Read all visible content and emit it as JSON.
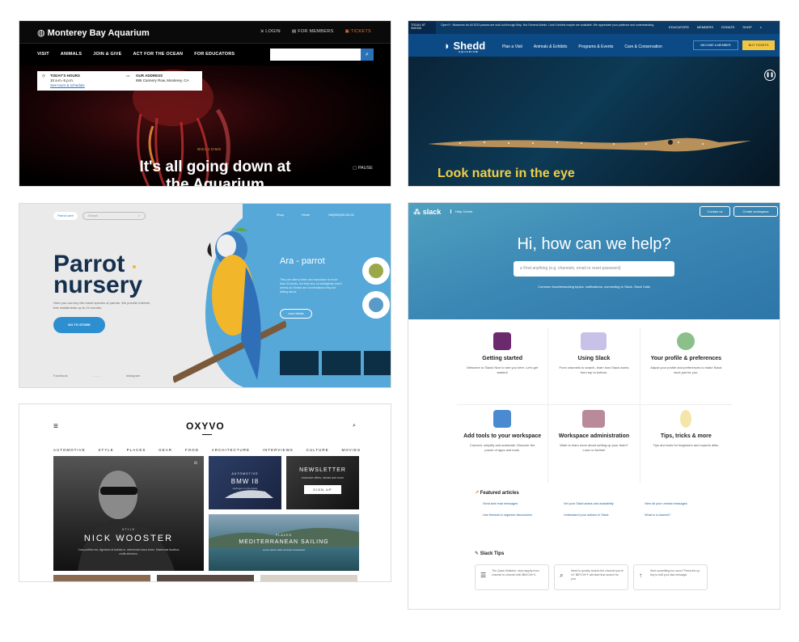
{
  "monterey": {
    "logo": "Monterey Bay Aquarium",
    "top_nav": [
      "LOGIN",
      "FOR MEMBERS",
      "TICKETS"
    ],
    "main_nav": [
      "VISIT",
      "ANIMALS",
      "JOIN & GIVE",
      "ACT FOR THE OCEAN",
      "FOR EDUCATORS"
    ],
    "hours_label": "TODAY'S HOURS",
    "hours_value": "10 a.m.-5 p.m.",
    "hours_link": "See tours & schedule",
    "address_label": "OUR ADDRESS",
    "address_value": "886 Cannery Row, Monterey, CA",
    "kicker": "WELCOME",
    "hero": "It's all going down at the Aquarium",
    "pause": "PAUSE"
  },
  "shedd": {
    "today_label": "TODAY AT SHEDD",
    "open_label": "Open 9",
    "alert": "Museums for All 2023 passes are sold out through May. Not General Admin. Limit 4 tickets maybe are available. We appreciate your patience and understanding.",
    "util_nav": [
      "EDUCATORS",
      "MEMBERS",
      "DONATE",
      "SHOP"
    ],
    "logo": "Shedd",
    "logo_sub": "AQUARIUM",
    "main_nav": [
      "Plan a Visit",
      "Animals & Exhibits",
      "Programs & Events",
      "Care & Conservation"
    ],
    "member_button": "BECOME A MEMBER",
    "tickets_button": "BUY TICKETS",
    "hero": "Look nature in the eye"
  },
  "parrot": {
    "logo": "Parrot care",
    "search_placeholder": "Search",
    "nav": [
      "Shop",
      "Home",
      "+38(000)000-00-00"
    ],
    "title_line1": "Parrot",
    "title_line2": "nursery",
    "description": "Here you can buy the rarest species of parrots. We provide interest-free installments up to 24 months.",
    "store_button": "GO TO STORE",
    "footer": [
      "Facebook",
      "Instagram"
    ],
    "species_title": "Ara - parrot",
    "species_text": "They are able to learn and reproduce no more than 30 words, but they stun us intelligently that it seems as if these are conversations they are talking about.",
    "more_button": "more details"
  },
  "slack": {
    "logo": "slack",
    "help_centre": "Help Centre",
    "contact_button": "Contact us",
    "create_button": "Create workspace",
    "title": "Hi, how can we help?",
    "search_placeholder": "Find anything (e.g. channels, email or reset password)",
    "common_topics": "Common troubleshooting topics: notifications, connecting to Slack, Slack Calls",
    "cards": [
      {
        "title": "Getting started",
        "text": "Welcome to Slack! Nice to see you here. Let's get started!",
        "icon": "book-icon"
      },
      {
        "title": "Using Slack",
        "text": "From channels to search, learn how Slack works from top to bottom.",
        "icon": "screen-icon"
      },
      {
        "title": "Your profile & preferences",
        "text": "Adjust your profile and preferences to make Slack work just for you.",
        "icon": "profile-icon"
      },
      {
        "title": "Add tools to your workspace",
        "text": "Connect, simplify and automate. Discover the power of apps and tools.",
        "icon": "tools-icon"
      },
      {
        "title": "Workspace administration",
        "text": "Want to learn more about setting up your team? Look no further!",
        "icon": "admin-icon"
      },
      {
        "title": "Tips, tricks & more",
        "text": "Tips and tools for beginners and experts alike.",
        "icon": "lightbulb-icon"
      }
    ],
    "featured_heading": "Featured articles",
    "featured": [
      "Send and read messages",
      "Set your Slack status and availability",
      "View all your unread messages",
      "Use threads to organize discussions",
      "Understand your actions in Slack",
      "What is a channel?"
    ],
    "tips_heading": "Slack Tips",
    "tips": [
      "The Quick Switcher: skip happily from channel to channel with ⌘K/Ctrl+K.",
      "Need to quickly search the channel you're in? ⌘F/Ctrl+F will start that search for you.",
      "Sent something too soon? Press the up key to edit your last message."
    ]
  },
  "oxyvo": {
    "logo": "OXYVO",
    "nav": [
      "AUTOMOTIVE",
      "STYLE",
      "PLACES",
      "GEAR",
      "FOOD",
      "ARCHITECTURE",
      "INTERVIEWS",
      "CULTURE",
      "MOVIES"
    ],
    "feature_kicker": "STYLE",
    "feature_title": "NICK WOOSTER",
    "feature_desc": "Cras porttitor est, dignissim at facilisis in, elementum lacus lorem. Maecenas faucibus mollis interdum.",
    "bmw_kicker": "AUTOMOTIVE",
    "bmw_title": "BMW I8",
    "bmw_desc": "Hydrogen on the future",
    "newsletter_title": "NEWSLETTER",
    "newsletter_desc": "exclusive offers, stories and more",
    "signup_button": "SIGN UP",
    "sail_kicker": "PLACES",
    "sail_title": "MEDITERRANEAN SAILING",
    "sail_desc": "Lorem ipsum dolor sit amet consectetur"
  }
}
